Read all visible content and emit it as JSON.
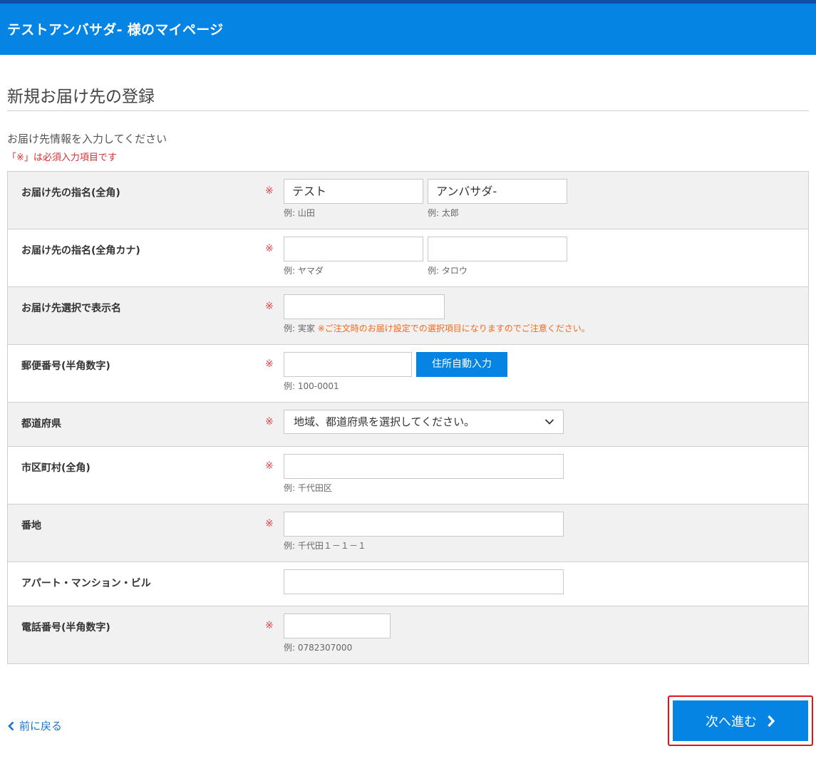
{
  "header": {
    "title": "テストアンバサダ- 様のマイページ"
  },
  "page": {
    "title": "新規お届け先の登録",
    "intro": "お届け先情報を入力してください",
    "required_note": "「※」は必須入力項目です"
  },
  "required_mark": "※",
  "form": {
    "name": {
      "label": "お届け先の指名(全角)",
      "last_value": "テスト",
      "first_value": "アンバサダ-",
      "last_hint": "例: 山田",
      "first_hint": "例: 太郎"
    },
    "kana": {
      "label": "お届け先の指名(全角カナ)",
      "last_value": "",
      "first_value": "",
      "last_hint": "例: ヤマダ",
      "first_hint": "例: タロウ"
    },
    "display_name": {
      "label": "お届け先選択で表示名",
      "value": "",
      "hint": "例: 実家",
      "warning": "※ご注文時のお届け設定での選択項目になりますのでご注意ください。"
    },
    "postal": {
      "label": "郵便番号(半角数字)",
      "value": "",
      "hint": "例: 100-0001",
      "auto_button": "住所自動入力"
    },
    "prefecture": {
      "label": "都道府県",
      "selected": "地域、都道府県を選択してください。"
    },
    "city": {
      "label": "市区町村(全角)",
      "value": "",
      "hint": "例: 千代田区"
    },
    "street": {
      "label": "番地",
      "value": "",
      "hint": "例: 千代田１－１－１"
    },
    "building": {
      "label": "アパート・マンション・ビル",
      "value": ""
    },
    "phone": {
      "label": "電話番号(半角数字)",
      "value": "",
      "hint": "例: 0782307000"
    }
  },
  "footer": {
    "back_label": "前に戻る",
    "next_label": "次へ進む"
  },
  "colors": {
    "header_bg": "#0584e3",
    "header_stripe": "#0f4fa8",
    "required": "#e0474c",
    "warning": "#f26a1b",
    "highlight_border": "#e0151b"
  },
  "icons": {
    "back": "chevron-left-icon",
    "next": "chevron-right-icon",
    "select": "chevron-down-icon"
  }
}
